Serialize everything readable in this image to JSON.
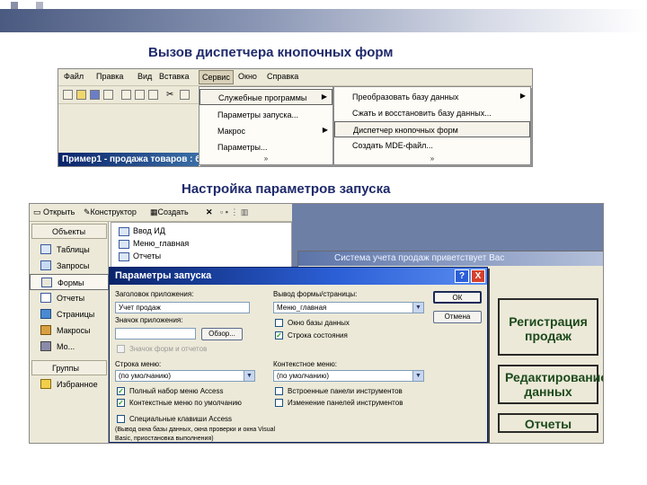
{
  "slide": {
    "heading1": "Вызов диспетчера кнопочных форм",
    "heading2": "Настройка параметров запуска"
  },
  "shot1": {
    "menu": [
      "Файл",
      "Правка",
      "Вид",
      "Вставка",
      "Сервис",
      "Окно",
      "Справка"
    ],
    "selected_menu": "Сервис",
    "db_title": "Пример1 - продажа товаров : б...",
    "tools_menu": [
      {
        "label": "Служебные программы",
        "submenu": true
      },
      {
        "label": "Параметры запуска...",
        "submenu": false
      },
      {
        "label": "Макрос",
        "submenu": true
      },
      {
        "label": "Параметры...",
        "submenu": false
      }
    ],
    "utilities_menu": [
      {
        "label": "Преобразовать базу данных",
        "submenu": true
      },
      {
        "label": "Сжать и восстановить базу данных...",
        "submenu": false
      },
      {
        "label": "Диспетчер кнопочных форм",
        "submenu": false
      },
      {
        "label": "Создать MDE-файл...",
        "submenu": false
      }
    ],
    "more_chevron": "»"
  },
  "shot2": {
    "toolbar": {
      "open": "Открыть",
      "design": "Конструктор",
      "create": "Создать"
    },
    "objects_header": "Объекты",
    "objects": [
      "Таблицы",
      "Запросы",
      "Формы",
      "Отчеты",
      "Страницы",
      "Макросы",
      "Мо..."
    ],
    "selected_object": "Формы",
    "groups_header": "Группы",
    "favorites": "Избранное",
    "list_items": [
      "Ввод ИД",
      "Меню_главная",
      "Отчеты"
    ],
    "form_title": "Система учета продаж приветствует Вас",
    "form_buttons": [
      "Регистрация продаж",
      "Редактирование данных",
      "Отчеты"
    ],
    "dialog": {
      "title": "Параметры запуска",
      "app_title_label": "Заголовок приложения:",
      "app_title_value": "Учет продаж",
      "app_icon_label": "Значок приложения:",
      "app_icon_value": "",
      "browse_button": "Обзор...",
      "icon_for_forms": "Значок форм и отчетов",
      "form_label": "Вывод формы/страницы:",
      "form_value": "Меню_главная",
      "db_window": "Окно базы данных",
      "status_bar": "Строка состояния",
      "menu_bar_label": "Строка меню:",
      "menu_bar_value": "(по умолчанию)",
      "full_menus": "Полный набор меню Access",
      "context_menus": "Контекстные меню по умолчанию",
      "context_menu_bar_label": "Контекстное меню:",
      "context_menu_bar_value": "(по умолчанию)",
      "builtin_toolbars": "Встроенные панели инструментов",
      "toolbar_changes": "Изменение панелей инструментов",
      "special_keys": "Специальные клавиши Access",
      "special_keys_note": "(Вывод окна базы данных, окна проверки и окна Visual Basic, приостановка выполнения)",
      "ok": "ОК",
      "cancel": "Отмена",
      "help": "?",
      "close": "X"
    }
  }
}
